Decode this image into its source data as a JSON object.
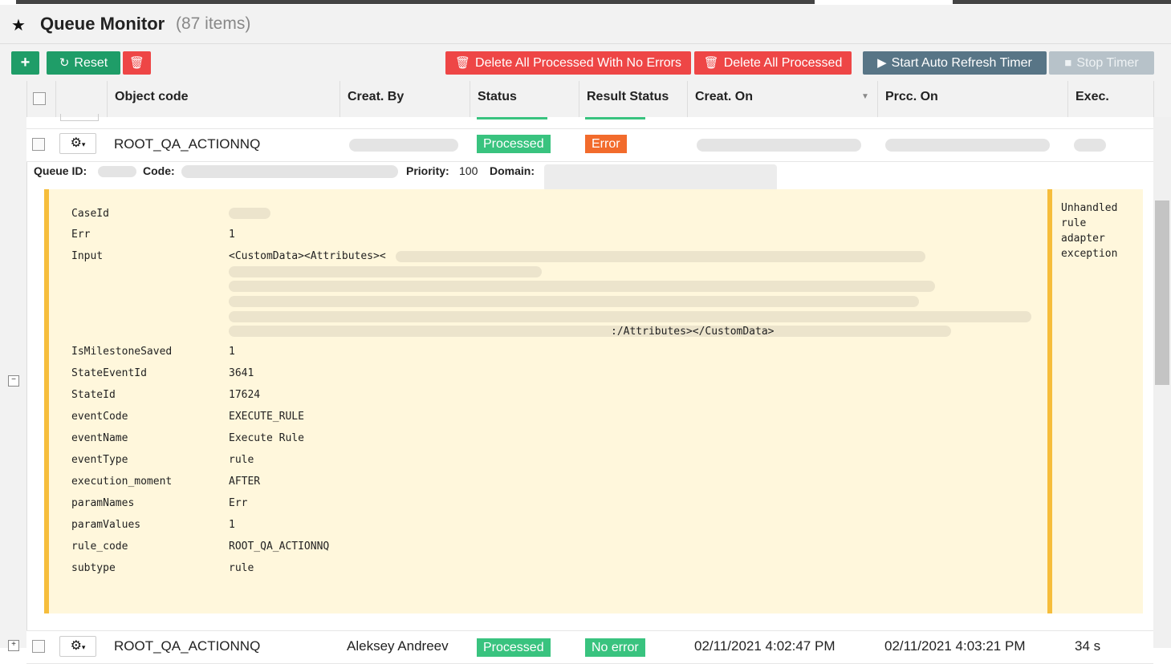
{
  "header": {
    "title": "Queue Monitor",
    "count": "(87 items)"
  },
  "toolbar": {
    "reset_label": "Reset",
    "delete_no_errors_label": "Delete All Processed With No Errors",
    "delete_all_label": "Delete All Processed",
    "start_timer_label": "Start Auto Refresh Timer",
    "stop_timer_label": "Stop Timer"
  },
  "columns": {
    "object_code": "Object code",
    "created_by": "Creat. By",
    "status": "Status",
    "result_status": "Result Status",
    "created_on": "Creat. On",
    "processed_on": "Prcc. On",
    "exec": "Exec."
  },
  "row1": {
    "object_code": "ROOT_QA_ACTIONNQ",
    "status": "Processed",
    "result_status": "Error"
  },
  "meta": {
    "queue_id_label": "Queue ID:",
    "code_label": "Code:",
    "priority_label": "Priority:",
    "priority_value": "100",
    "domain_label": "Domain:"
  },
  "detail": {
    "error_message": "Unhandled rule adapter exception",
    "input_prefix": "<CustomData><Attributes><",
    "input_suffix": ":/Attributes></CustomData>",
    "fields": [
      {
        "key": "CaseId",
        "value": ""
      },
      {
        "key": "Err",
        "value": "1"
      },
      {
        "key": "Input",
        "value": ""
      },
      {
        "key": "IsMilestoneSaved",
        "value": "1"
      },
      {
        "key": "StateEventId",
        "value": "3641"
      },
      {
        "key": "StateId",
        "value": "17624"
      },
      {
        "key": "eventCode",
        "value": "EXECUTE_RULE"
      },
      {
        "key": "eventName",
        "value": "Execute Rule"
      },
      {
        "key": "eventType",
        "value": "rule"
      },
      {
        "key": "execution_moment",
        "value": "AFTER"
      },
      {
        "key": "paramNames",
        "value": "Err"
      },
      {
        "key": "paramValues",
        "value": "1"
      },
      {
        "key": "rule_code",
        "value": "ROOT_QA_ACTIONNQ"
      },
      {
        "key": "subtype",
        "value": "rule"
      }
    ]
  },
  "row2": {
    "object_code": "ROOT_QA_ACTIONNQ",
    "created_by": "Aleksey Andreev",
    "status": "Processed",
    "result_status": "No error",
    "created_on": "02/11/2021 4:02:47 PM",
    "processed_on": "02/11/2021 4:03:21 PM",
    "exec": "34 s"
  },
  "icons": {
    "star": "star-icon",
    "add": "plus-icon",
    "reset": "refresh-icon",
    "trash": "trash-icon",
    "play": "play-icon",
    "stop": "stop-icon",
    "gear": "gear-icon"
  },
  "colors": {
    "green": "#1f9d68",
    "red": "#ee4646",
    "slate": "#587586",
    "badge_green": "#39c37f",
    "badge_orange": "#f26b2c",
    "detail_bg": "#fff7dc",
    "detail_border": "#f6bd3b"
  }
}
